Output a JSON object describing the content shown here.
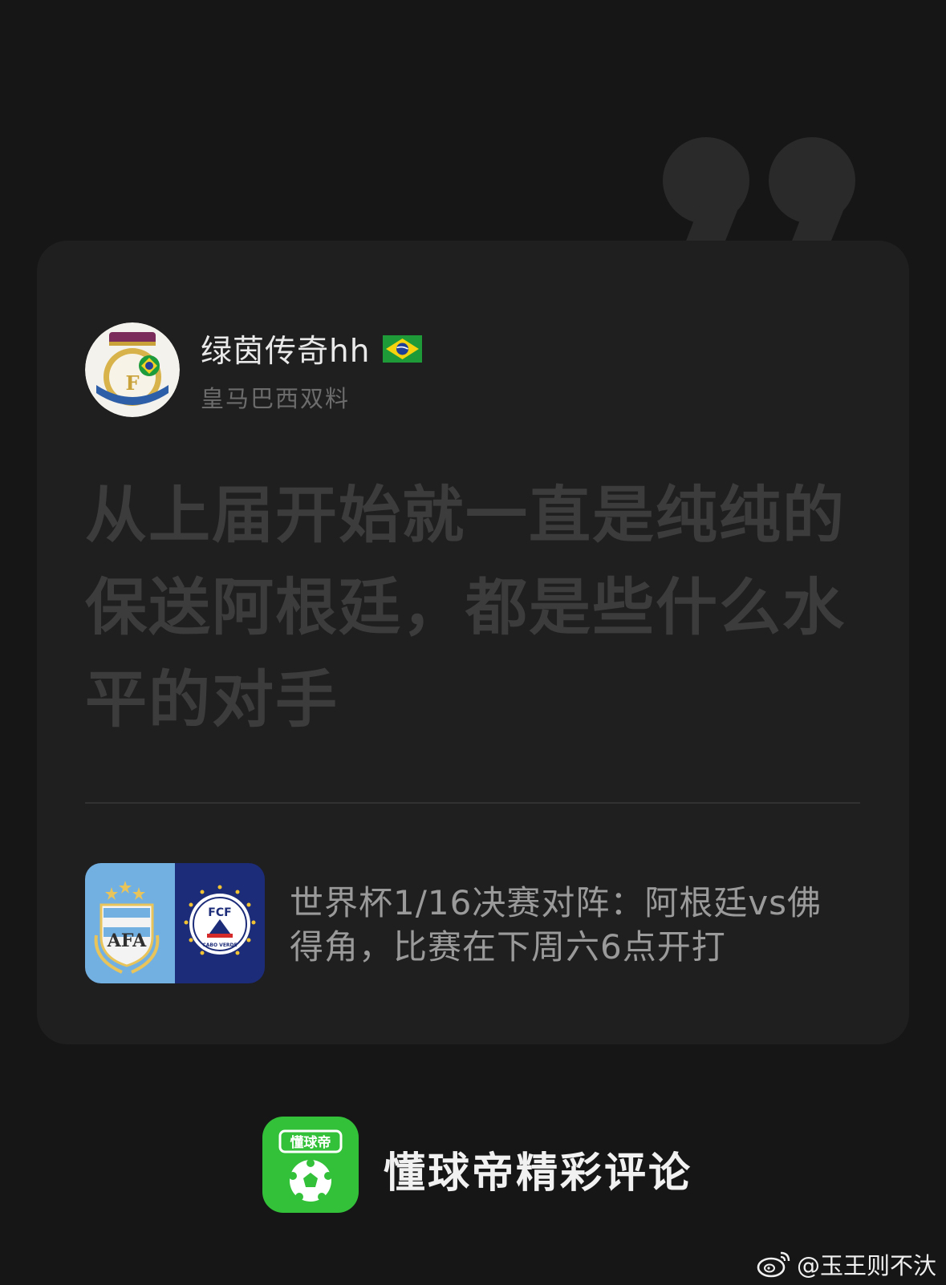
{
  "user": {
    "name": "绿茵传奇hh",
    "tag": "皇马巴西双料",
    "avatar_icon": "real-madrid-brazil-crest-avatar",
    "flag_icon": "brazil-flag-icon"
  },
  "comment": {
    "text": "从上届开始就一直是纯纯的保送阿根廷，都是些什么水平的对手"
  },
  "match": {
    "text": "世界杯1/16决赛对阵：阿根廷vs佛得角，比赛在下周六6点开打",
    "home_logo_text": "AFA",
    "away_logo_top": "FCF",
    "away_logo_bottom": "CABO VERDE"
  },
  "brand": {
    "logo_text": "懂球帝",
    "title": "懂球帝精彩评论"
  },
  "watermark": {
    "text": "@玉王则不汏"
  },
  "colors": {
    "background": "#161616",
    "card": "#1f1f1f",
    "brand_green": "#33c13a",
    "argentina_blue": "#73b0e2",
    "cabo_verde_blue": "#1c2c79"
  }
}
